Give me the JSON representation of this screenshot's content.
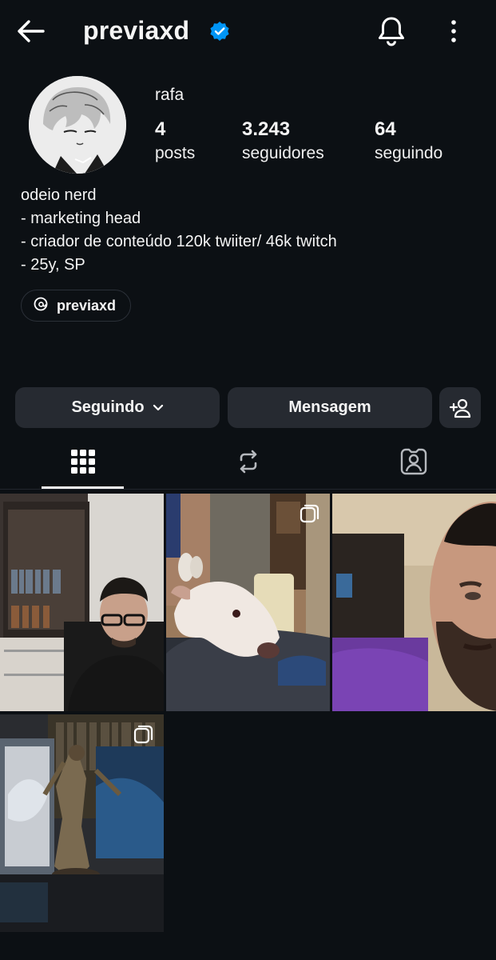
{
  "header": {
    "username": "previaxd"
  },
  "profile": {
    "display_name": "rafa",
    "stats": [
      {
        "value": "4",
        "label": "posts"
      },
      {
        "value": "3.243",
        "label": "seguidores"
      },
      {
        "value": "64",
        "label": "seguindo"
      }
    ],
    "bio": [
      "odeio nerd",
      "- marketing head",
      "- criador de conteúdo 120k twiiter/ 46k twitch",
      "- 25y, SP"
    ],
    "threads_handle": "previaxd"
  },
  "actions": {
    "following_label": "Seguindo",
    "message_label": "Mensagem"
  },
  "tabs": [
    {
      "icon": "grid-icon",
      "active": true
    },
    {
      "icon": "reels-repost-icon",
      "active": false
    },
    {
      "icon": "tagged-icon",
      "active": false
    }
  ],
  "colors": {
    "background": "#0c1014",
    "button": "#262a31",
    "verified": "#0095f6"
  }
}
